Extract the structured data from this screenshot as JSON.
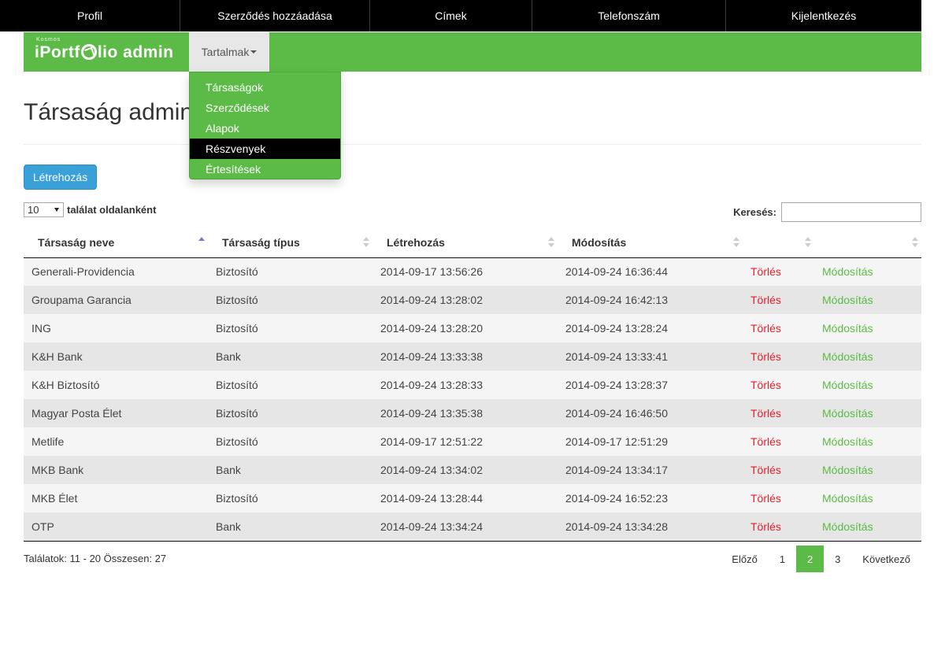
{
  "topnav": {
    "items": [
      "Profil",
      "Szerződés hozzáadása",
      "Címek",
      "Telefonszám",
      "Kijelentkezés"
    ]
  },
  "brand": {
    "small": "Kosmos",
    "name_before": "iPortf",
    "name_after": "lio admin"
  },
  "menu": {
    "label": "Tartalmak",
    "items": [
      "Társaságok",
      "Szerződések",
      "Alapok",
      "Részvenyek",
      "Értesítések"
    ],
    "active_index": 3
  },
  "page": {
    "title": "Társaság admin"
  },
  "actions": {
    "create_label": "Létrehozás"
  },
  "table_controls": {
    "page_length_value": "10",
    "page_length_suffix": "találat oldalanként",
    "search_label": "Keresés:",
    "search_value": ""
  },
  "table": {
    "columns": [
      "Társaság neve",
      "Társaság típus",
      "Létrehozás",
      "Módosítás",
      "",
      ""
    ],
    "sorted_column": 0,
    "sort_direction": "ascending",
    "delete_label": "Törlés",
    "modify_label": "Módosítás",
    "rows": [
      {
        "name": "Generali-Providencia",
        "type": "Biztosító",
        "created": "2014-09-17 13:56:26",
        "modified": "2014-09-24 16:36:44"
      },
      {
        "name": "Groupama Garancia",
        "type": "Biztosító",
        "created": "2014-09-24 13:28:02",
        "modified": "2014-09-24 16:42:13"
      },
      {
        "name": "ING",
        "type": "Biztosító",
        "created": "2014-09-24 13:28:20",
        "modified": "2014-09-24 13:28:24"
      },
      {
        "name": "K&H Bank",
        "type": "Bank",
        "created": "2014-09-24 13:33:38",
        "modified": "2014-09-24 13:33:41"
      },
      {
        "name": "K&H Biztosító",
        "type": "Biztosító",
        "created": "2014-09-24 13:28:33",
        "modified": "2014-09-24 13:28:37"
      },
      {
        "name": "Magyar Posta Élet",
        "type": "Biztosító",
        "created": "2014-09-24 13:35:38",
        "modified": "2014-09-24 16:46:50"
      },
      {
        "name": "Metlife",
        "type": "Biztosító",
        "created": "2014-09-17 12:51:22",
        "modified": "2014-09-17 12:51:29"
      },
      {
        "name": "MKB Bank",
        "type": "Bank",
        "created": "2014-09-24 13:34:02",
        "modified": "2014-09-24 13:34:17"
      },
      {
        "name": "MKB Élet",
        "type": "Biztosító",
        "created": "2014-09-24 13:28:44",
        "modified": "2014-09-24 16:52:23"
      },
      {
        "name": "OTP",
        "type": "Bank",
        "created": "2014-09-24 13:34:24",
        "modified": "2014-09-24 13:34:28"
      }
    ]
  },
  "footer": {
    "info": "Találatok: 11 - 20 Összesen: 27",
    "pagination": {
      "prev": "Előző",
      "pages": [
        "1",
        "2",
        "3"
      ],
      "current": "2",
      "next": "Következő"
    }
  },
  "colors": {
    "brand_green": "#5cba47",
    "topbar_black": "#000000",
    "create_blue": "#3aa0d8",
    "delete_red": "#e0202a"
  }
}
